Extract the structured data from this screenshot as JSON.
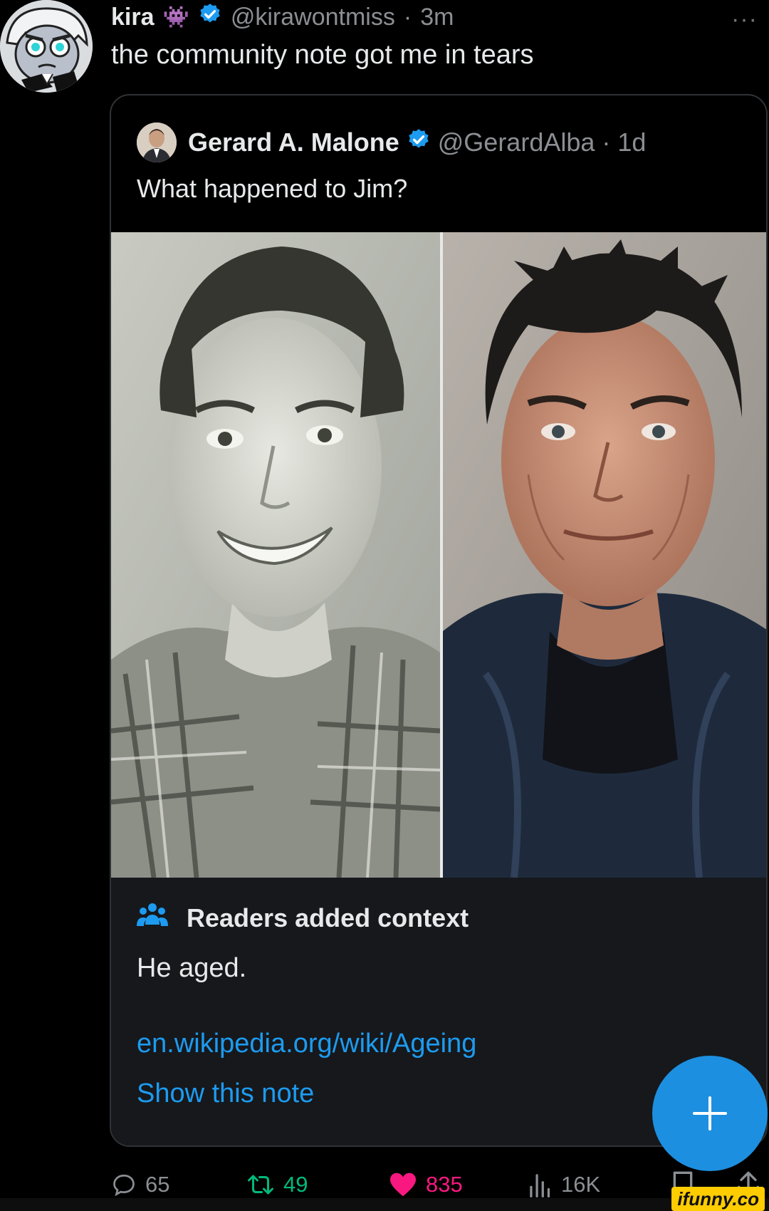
{
  "tweet": {
    "author_name": "kira",
    "emoji": "👾",
    "handle": "@kirawontmiss",
    "separator": "·",
    "time": "3m",
    "more": "···",
    "text": "the community note got me in tears"
  },
  "quote": {
    "author_name": "Gerard A. Malone",
    "handle": "@GerardAlba",
    "separator": "·",
    "time": "1d",
    "text": "What happened to Jim?"
  },
  "community_note": {
    "title": "Readers added context",
    "body": "He aged.",
    "link": "en.wikipedia.org/wiki/Ageing",
    "show_label": "Show this note"
  },
  "actions": {
    "replies": "65",
    "reposts": "49",
    "likes": "835",
    "views": "16K"
  },
  "watermark": "ifunny.co",
  "colors": {
    "background": "#000000",
    "accent": "#1d9bf0",
    "repost": "#00ba7c",
    "like": "#f91880",
    "muted": "#8b8f94",
    "verified": "#1d9bf0"
  }
}
